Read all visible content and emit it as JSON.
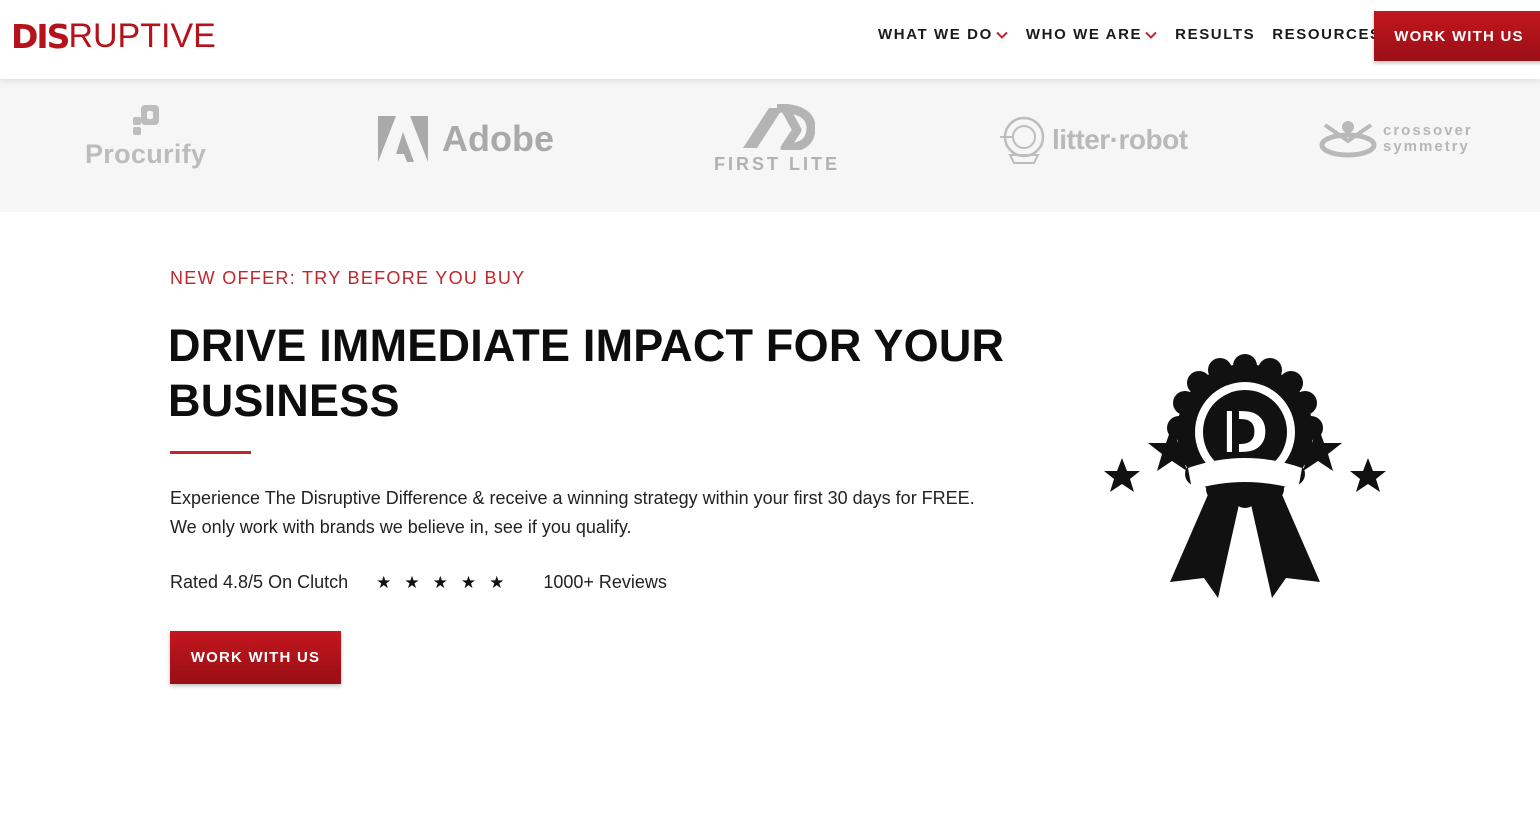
{
  "header": {
    "logo": {
      "part1": "DIS",
      "part2": "RUPTIVE"
    },
    "nav": [
      {
        "label": "WHAT WE DO",
        "has_dropdown": true
      },
      {
        "label": "WHO WE ARE",
        "has_dropdown": true
      },
      {
        "label": "RESULTS",
        "has_dropdown": false
      },
      {
        "label": "RESOURCES",
        "has_dropdown": true
      }
    ],
    "cta_label": "WORK WITH US"
  },
  "client_logos": [
    {
      "name": "Procurify",
      "icon": "procurify-icon"
    },
    {
      "name": "Adobe",
      "icon": "adobe-icon"
    },
    {
      "name": "FIRST LITE",
      "icon": "first-lite-icon"
    },
    {
      "name": "litter·robot",
      "icon": "litter-robot-icon"
    },
    {
      "name_line1": "CROSSOVER",
      "name_line2": "SYMMETRY",
      "icon": "crossover-symmetry-icon"
    }
  ],
  "hero": {
    "eyebrow": "NEW OFFER: TRY BEFORE YOU BUY",
    "headline_line1": "DRIVE IMMEDIATE IMPACT FOR YOUR",
    "headline_line2": "BUSINESS",
    "description_line1": "Experience The Disruptive Difference & receive a winning strategy within your first 30 days for FREE.",
    "description_line2": "We only work with brands we believe in, see if you qualify.",
    "rating_text": "Rated 4.8/5 On Clutch",
    "stars": "★★★★★",
    "reviews_text": "1000+ Reviews",
    "cta_label": "WORK WITH US",
    "badge_icon": "award-ribbon-icon"
  },
  "colors": {
    "brand_red": "#c0272d",
    "button_red": "#b5121b",
    "logo_strip_bg": "#f6f6f7"
  }
}
